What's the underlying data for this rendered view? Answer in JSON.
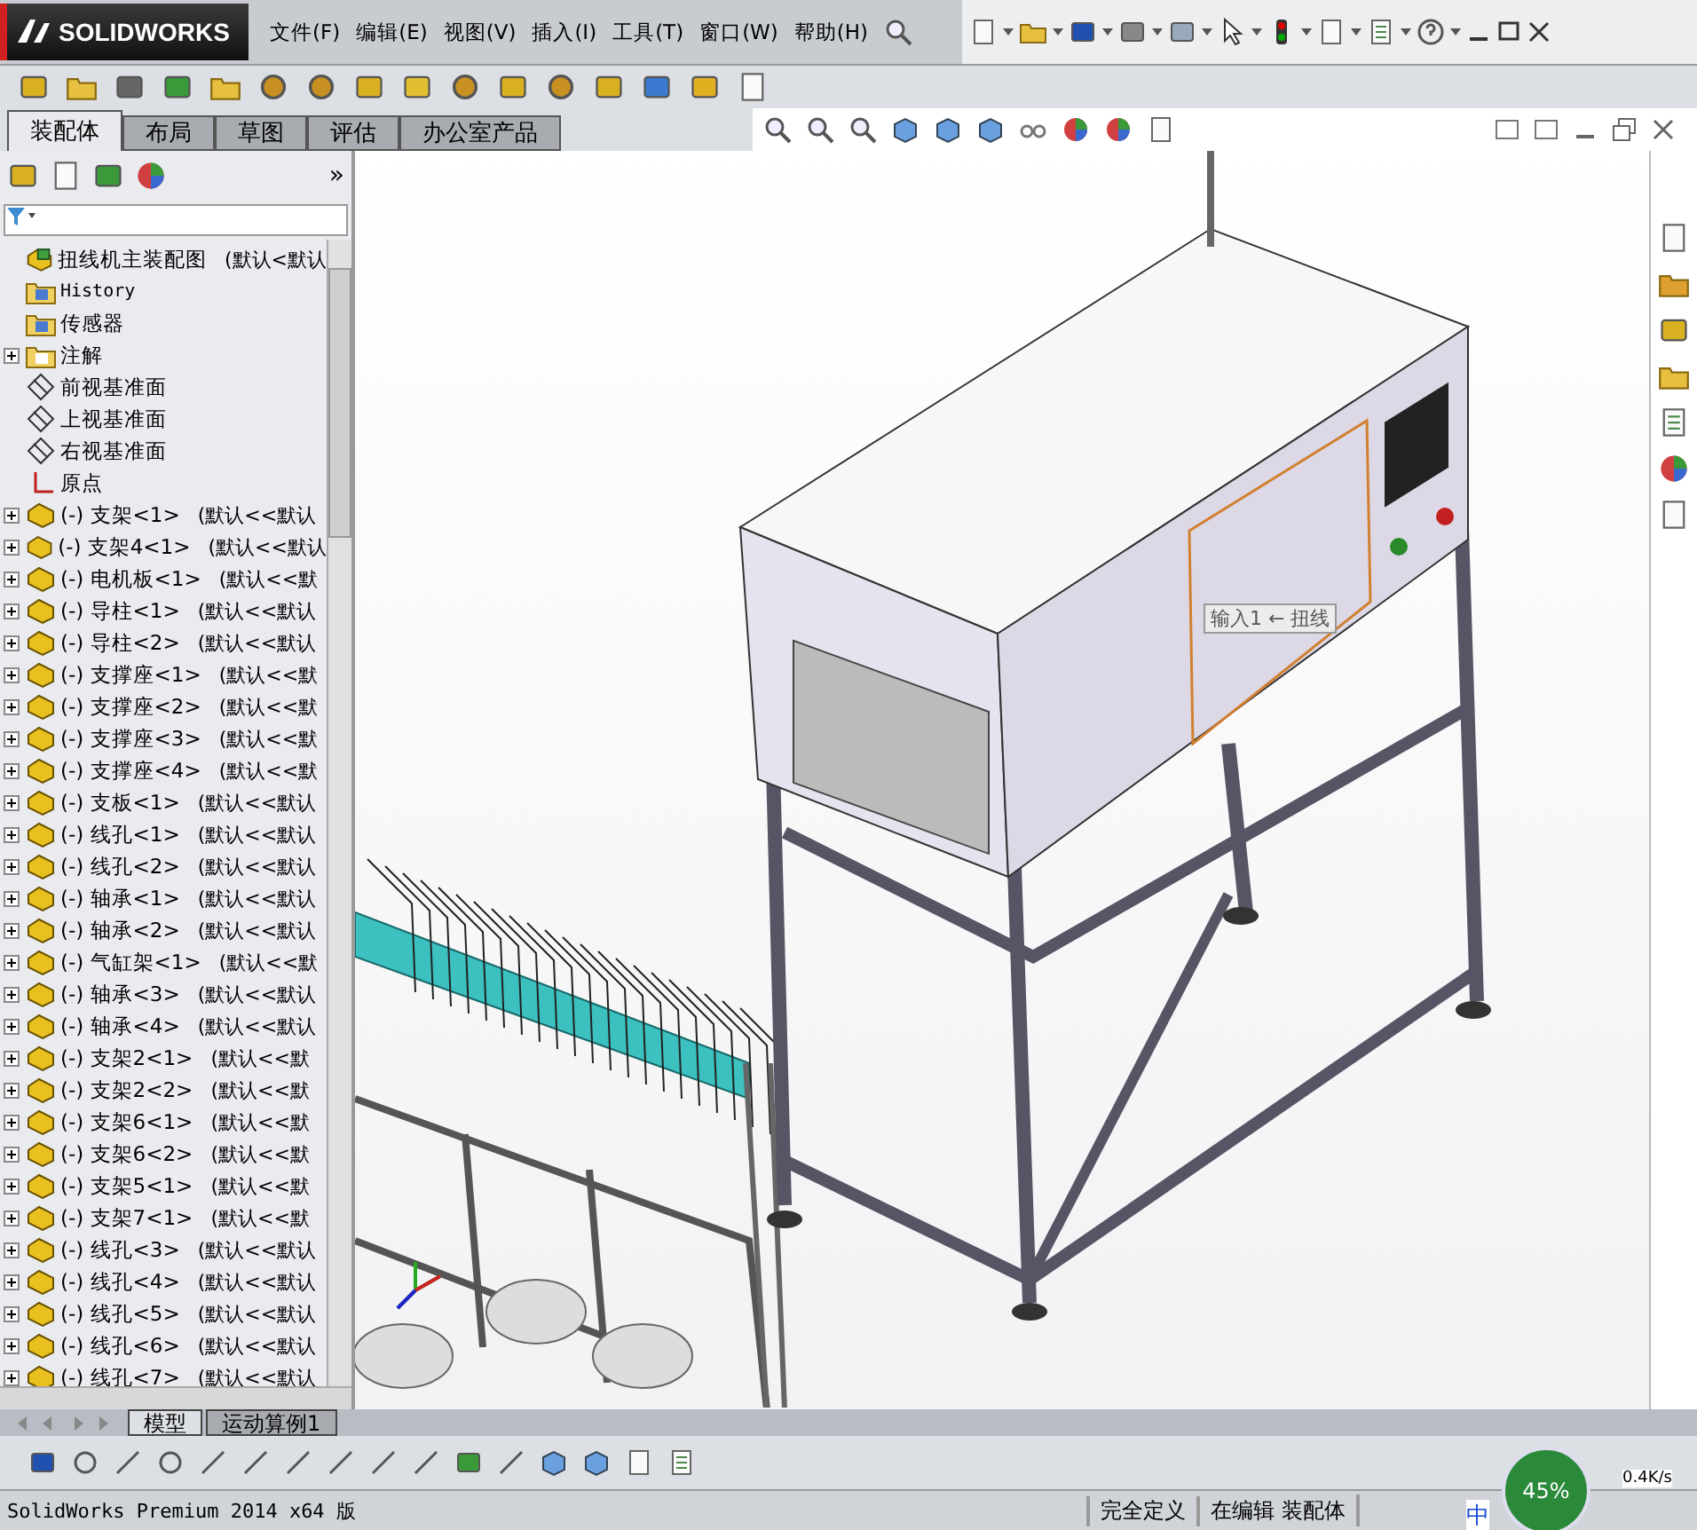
{
  "app": {
    "logo": "SOLIDWORKS"
  },
  "menu": [
    "文件(F)",
    "编辑(E)",
    "视图(V)",
    "插入(I)",
    "工具(T)",
    "窗口(W)",
    "帮助(H)"
  ],
  "tabs": [
    {
      "label": "装配体",
      "selected": true
    },
    {
      "label": "布局",
      "selected": false
    },
    {
      "label": "草图",
      "selected": false
    },
    {
      "label": "评估",
      "selected": false
    },
    {
      "label": "办公室产品",
      "selected": false
    }
  ],
  "panel": {
    "more": "»",
    "tree": [
      {
        "kind": "assembly",
        "label": "扭线机主装配图",
        "config": "(默认<默认",
        "expandable": false
      },
      {
        "kind": "history",
        "label": "History",
        "expandable": false
      },
      {
        "kind": "sensor",
        "label": "传感器",
        "expandable": false
      },
      {
        "kind": "annotation",
        "label": "注解",
        "expandable": true
      },
      {
        "kind": "plane",
        "label": "前视基准面",
        "expandable": false
      },
      {
        "kind": "plane",
        "label": "上视基准面",
        "expandable": false
      },
      {
        "kind": "plane",
        "label": "右视基准面",
        "expandable": false
      },
      {
        "kind": "origin",
        "label": "原点",
        "expandable": false
      },
      {
        "kind": "part",
        "label": "(-) 支架<1>",
        "config": "(默认<<默认",
        "expandable": true
      },
      {
        "kind": "part",
        "label": "(-) 支架4<1>",
        "config": "(默认<<默认",
        "expandable": true
      },
      {
        "kind": "part",
        "label": "(-) 电机板<1>",
        "config": "(默认<<默",
        "expandable": true
      },
      {
        "kind": "part",
        "label": "(-) 导柱<1>",
        "config": "(默认<<默认",
        "expandable": true
      },
      {
        "kind": "part",
        "label": "(-) 导柱<2>",
        "config": "(默认<<默认",
        "expandable": true
      },
      {
        "kind": "part",
        "label": "(-) 支撑座<1>",
        "config": "(默认<<默",
        "expandable": true
      },
      {
        "kind": "part",
        "label": "(-) 支撑座<2>",
        "config": "(默认<<默",
        "expandable": true
      },
      {
        "kind": "part",
        "label": "(-) 支撑座<3>",
        "config": "(默认<<默",
        "expandable": true
      },
      {
        "kind": "part",
        "label": "(-) 支撑座<4>",
        "config": "(默认<<默",
        "expandable": true
      },
      {
        "kind": "part",
        "label": "(-) 支板<1>",
        "config": "(默认<<默认",
        "expandable": true
      },
      {
        "kind": "part",
        "label": "(-) 线孔<1>",
        "config": "(默认<<默认",
        "expandable": true
      },
      {
        "kind": "part",
        "label": "(-) 线孔<2>",
        "config": "(默认<<默认",
        "expandable": true
      },
      {
        "kind": "part",
        "label": "(-) 轴承<1>",
        "config": "(默认<<默认",
        "expandable": true
      },
      {
        "kind": "part",
        "label": "(-) 轴承<2>",
        "config": "(默认<<默认",
        "expandable": true
      },
      {
        "kind": "part",
        "label": "(-) 气缸架<1>",
        "config": "(默认<<默",
        "expandable": true
      },
      {
        "kind": "part",
        "label": "(-) 轴承<3>",
        "config": "(默认<<默认",
        "expandable": true
      },
      {
        "kind": "part",
        "label": "(-) 轴承<4>",
        "config": "(默认<<默认",
        "expandable": true
      },
      {
        "kind": "part",
        "label": "(-) 支架2<1>",
        "config": "(默认<<默",
        "expandable": true
      },
      {
        "kind": "part",
        "label": "(-) 支架2<2>",
        "config": "(默认<<默",
        "expandable": true
      },
      {
        "kind": "part",
        "label": "(-) 支架6<1>",
        "config": "(默认<<默",
        "expandable": true
      },
      {
        "kind": "part",
        "label": "(-) 支架6<2>",
        "config": "(默认<<默",
        "expandable": true
      },
      {
        "kind": "part",
        "label": "(-) 支架5<1>",
        "config": "(默认<<默",
        "expandable": true
      },
      {
        "kind": "part",
        "label": "(-) 支架7<1>",
        "config": "(默认<<默",
        "expandable": true
      },
      {
        "kind": "part",
        "label": "(-) 线孔<3>",
        "config": "(默认<<默认",
        "expandable": true
      },
      {
        "kind": "part",
        "label": "(-) 线孔<4>",
        "config": "(默认<<默认",
        "expandable": true
      },
      {
        "kind": "part",
        "label": "(-) 线孔<5>",
        "config": "(默认<<默认",
        "expandable": true
      },
      {
        "kind": "part",
        "label": "(-) 线孔<6>",
        "config": "(默认<<默认",
        "expandable": true
      },
      {
        "kind": "part",
        "label": "(-) 线孔<7>",
        "config": "(默认<<默认",
        "expandable": true
      }
    ]
  },
  "viewport": {
    "tooltip": "输入1 ← 扭线"
  },
  "bottom_tabs": [
    {
      "label": "模型",
      "selected": true
    },
    {
      "label": "运动算例1",
      "selected": false
    }
  ],
  "status_bar": {
    "product": "SolidWorks Premium 2014 x64 版",
    "fields": [
      "完全定义",
      "在编辑 装配体"
    ]
  },
  "tray": {
    "percent": "45%",
    "speed": "0.4K/s",
    "ime": "中"
  }
}
